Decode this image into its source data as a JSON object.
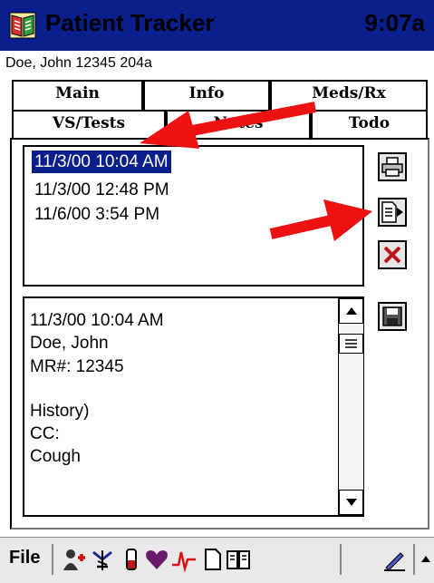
{
  "app": {
    "title": "Patient Tracker",
    "time": "9:07a",
    "patient_line": "Doe, John 12345 204a"
  },
  "tabs": {
    "main": "Main",
    "info": "Info",
    "meds": "Meds/Rx",
    "vs": "VS/Tests",
    "notes": "Notes",
    "todo": "Todo"
  },
  "notes_list": [
    "11/3/00 10:04 AM",
    "11/3/00 12:48 PM",
    "11/6/00 3:54 PM"
  ],
  "note_detail": [
    "11/3/00 10:04 AM",
    "Doe, John",
    "MR#: 12345",
    "",
    "History)",
    "CC:",
    "Cough"
  ],
  "toolbar": {
    "print_icon": "printer-icon",
    "export_icon": "export-note-icon",
    "delete_icon": "delete-x-icon",
    "save_icon": "save-disk-icon"
  },
  "menubar": {
    "file_label": "File"
  },
  "colors": {
    "titlebar": "#0a1e8c",
    "selection": "#0a1e8c",
    "arrow": "#ee1111"
  }
}
